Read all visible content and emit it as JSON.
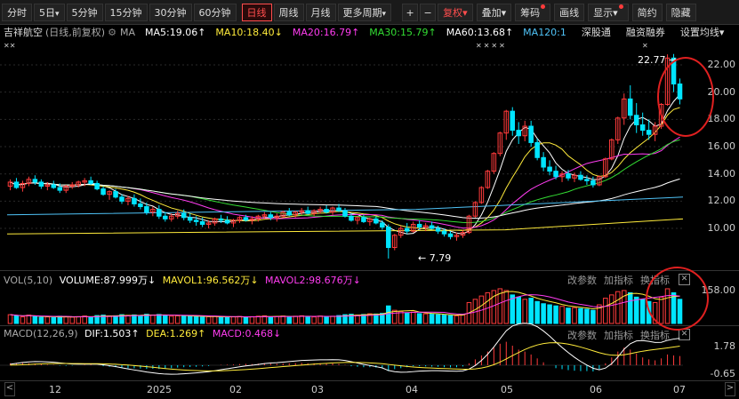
{
  "toolbar": {
    "periods": [
      "分时",
      "5日",
      "5分钟",
      "15分钟",
      "30分钟",
      "60分钟",
      "日线",
      "周线",
      "月线",
      "更多周期"
    ],
    "active": "日线",
    "plus": "+",
    "minus": "−",
    "fq": "复权",
    "right": [
      "叠加",
      "筹码",
      "画线",
      "显示",
      "简约",
      "隐藏"
    ]
  },
  "stock": {
    "name": "吉祥航空",
    "mode": "(日线,前复权)"
  },
  "ma": {
    "label": "MA",
    "items": [
      {
        "text": "MA5:19.06",
        "arrow": "↑",
        "color": "#ffffff"
      },
      {
        "text": "MA10:18.40",
        "arrow": "↓",
        "color": "#ffeb3b"
      },
      {
        "text": "MA20:16.79",
        "arrow": "↑",
        "color": "#ff3cf0"
      },
      {
        "text": "MA30:15.79",
        "arrow": "↑",
        "color": "#33dd33"
      },
      {
        "text": "MA60:13.68",
        "arrow": "↑",
        "color": "#ffffff"
      },
      {
        "text": "MA120:1",
        "arrow": "",
        "color": "#4fc3f7"
      }
    ],
    "links": [
      "深股通",
      "融资融券",
      "设置均线"
    ]
  },
  "vol": {
    "label": "VOL(5,10)",
    "volume": "VOLUME:87.999万",
    "mavol1": "MAVOL1:96.562万",
    "mavol2": "MAVOL2:98.676万",
    "arrow": "↓",
    "tools": [
      "改参数",
      "加指标",
      "换指标"
    ],
    "y": [
      "158.00"
    ]
  },
  "macd": {
    "label": "MACD(12,26,9)",
    "dif": "DIF:1.503",
    "dea": "DEA:1.269",
    "macd": "MACD:0.468",
    "tools": [
      "改参数",
      "加指标",
      "换指标"
    ],
    "y": [
      "1.78",
      "-0.65"
    ]
  },
  "annotations": {
    "high": "22.77",
    "low": "7.79"
  },
  "colors": {
    "up": "#ff3b3b",
    "down": "#00e5ff",
    "ma5": "#ffffff",
    "ma10": "#ffeb3b",
    "ma20": "#ff3cf0",
    "ma30": "#33dd33",
    "ma60": "#ffffff",
    "ma120": "#4fc3f7"
  },
  "chart_data": {
    "type": "candlestick",
    "y_ticks": [
      10,
      12,
      14,
      16,
      18,
      20,
      22
    ],
    "y_tick_labels": [
      "10.00",
      "12.00",
      "14.00",
      "16.00",
      "18.00",
      "20.00",
      "22.00"
    ],
    "ylim": [
      7.2,
      23.5
    ],
    "x_labels": [
      "12",
      "2025",
      "02",
      "03",
      "04",
      "05",
      "06",
      "07"
    ],
    "candles": [
      [
        13.1,
        13.6,
        12.8,
        13.4
      ],
      [
        13.4,
        13.7,
        12.9,
        13.0
      ],
      [
        13.0,
        13.5,
        12.7,
        13.3
      ],
      [
        13.3,
        13.8,
        13.1,
        13.6
      ],
      [
        13.6,
        13.9,
        13.2,
        13.4
      ],
      [
        13.4,
        13.6,
        12.9,
        13.1
      ],
      [
        13.1,
        13.4,
        12.8,
        13.2
      ],
      [
        13.2,
        13.5,
        12.9,
        13.0
      ],
      [
        13.0,
        13.3,
        12.6,
        12.8
      ],
      [
        12.8,
        13.2,
        12.6,
        13.1
      ],
      [
        13.1,
        13.4,
        12.9,
        13.2
      ],
      [
        13.2,
        13.5,
        13.0,
        13.4
      ],
      [
        13.4,
        13.7,
        13.1,
        13.5
      ],
      [
        13.5,
        13.8,
        13.2,
        13.3
      ],
      [
        13.3,
        13.5,
        12.8,
        12.9
      ],
      [
        12.9,
        13.1,
        12.4,
        12.5
      ],
      [
        12.5,
        12.8,
        12.1,
        12.7
      ],
      [
        12.7,
        12.9,
        12.2,
        12.3
      ],
      [
        12.3,
        12.5,
        11.8,
        12.0
      ],
      [
        12.0,
        12.4,
        11.7,
        12.2
      ],
      [
        12.2,
        12.5,
        11.6,
        11.8
      ],
      [
        11.8,
        12.2,
        11.4,
        11.6
      ],
      [
        11.6,
        11.9,
        11.0,
        11.2
      ],
      [
        11.2,
        11.6,
        10.9,
        11.4
      ],
      [
        11.4,
        11.7,
        10.7,
        10.9
      ],
      [
        10.9,
        11.2,
        10.5,
        10.7
      ],
      [
        10.7,
        11.1,
        10.5,
        10.9
      ],
      [
        10.9,
        11.3,
        10.7,
        11.1
      ],
      [
        11.1,
        11.4,
        10.6,
        10.8
      ],
      [
        10.8,
        11.1,
        10.4,
        10.6
      ],
      [
        10.6,
        10.9,
        10.2,
        10.5
      ],
      [
        10.5,
        10.8,
        10.1,
        10.3
      ],
      [
        10.3,
        10.6,
        10.0,
        10.4
      ],
      [
        10.4,
        10.8,
        10.2,
        10.7
      ],
      [
        10.7,
        11.0,
        10.4,
        10.6
      ],
      [
        10.6,
        10.9,
        10.3,
        10.4
      ],
      [
        10.4,
        10.7,
        10.1,
        10.6
      ],
      [
        10.6,
        10.9,
        10.4,
        10.8
      ],
      [
        10.8,
        11.0,
        10.5,
        10.6
      ],
      [
        10.6,
        10.9,
        10.3,
        10.7
      ],
      [
        10.7,
        11.0,
        10.5,
        10.9
      ],
      [
        10.9,
        11.2,
        10.7,
        11.0
      ],
      [
        11.0,
        11.2,
        10.6,
        10.8
      ],
      [
        10.8,
        11.1,
        10.5,
        10.9
      ],
      [
        10.9,
        11.3,
        10.8,
        11.2
      ],
      [
        11.2,
        11.5,
        10.9,
        11.0
      ],
      [
        11.0,
        11.3,
        10.8,
        11.2
      ],
      [
        11.2,
        11.5,
        11.0,
        11.3
      ],
      [
        11.3,
        11.6,
        11.0,
        11.1
      ],
      [
        11.1,
        11.4,
        10.9,
        11.3
      ],
      [
        11.3,
        11.6,
        11.1,
        11.4
      ],
      [
        11.4,
        11.7,
        11.1,
        11.2
      ],
      [
        11.2,
        11.6,
        11.0,
        11.5
      ],
      [
        11.5,
        11.8,
        11.2,
        11.3
      ],
      [
        11.3,
        11.5,
        10.8,
        10.9
      ],
      [
        10.9,
        11.1,
        10.5,
        10.6
      ],
      [
        10.6,
        10.9,
        10.3,
        10.8
      ],
      [
        10.8,
        11.0,
        10.4,
        10.5
      ],
      [
        10.5,
        10.8,
        10.2,
        10.7
      ],
      [
        10.7,
        10.9,
        10.3,
        10.4
      ],
      [
        10.4,
        10.6,
        9.9,
        10.1
      ],
      [
        10.1,
        10.3,
        7.79,
        8.6
      ],
      [
        8.6,
        9.6,
        8.4,
        9.5
      ],
      [
        9.5,
        10.2,
        9.3,
        10.0
      ],
      [
        10.0,
        10.4,
        9.6,
        9.8
      ],
      [
        9.8,
        10.5,
        9.7,
        10.3
      ],
      [
        10.3,
        10.6,
        9.9,
        10.1
      ],
      [
        10.1,
        10.4,
        9.8,
        10.2
      ],
      [
        10.2,
        10.5,
        9.9,
        10.0
      ],
      [
        10.0,
        10.2,
        9.6,
        9.8
      ],
      [
        9.8,
        10.0,
        9.4,
        9.6
      ],
      [
        9.6,
        9.8,
        9.2,
        9.4
      ],
      [
        9.4,
        9.7,
        9.1,
        9.5
      ],
      [
        9.5,
        9.9,
        9.3,
        9.7
      ],
      [
        9.7,
        11.0,
        9.6,
        10.9
      ],
      [
        10.9,
        12.0,
        10.8,
        11.9
      ],
      [
        11.9,
        13.1,
        11.8,
        13.0
      ],
      [
        13.0,
        14.3,
        12.9,
        14.2
      ],
      [
        14.2,
        15.6,
        14.0,
        15.5
      ],
      [
        15.5,
        17.1,
        15.3,
        17.0
      ],
      [
        17.0,
        18.7,
        16.5,
        18.6
      ],
      [
        18.6,
        18.9,
        16.8,
        17.2
      ],
      [
        17.2,
        17.8,
        16.2,
        16.8
      ],
      [
        16.8,
        17.9,
        16.4,
        17.5
      ],
      [
        17.5,
        17.9,
        16.0,
        16.3
      ],
      [
        16.3,
        16.6,
        15.0,
        15.2
      ],
      [
        15.2,
        15.6,
        14.2,
        14.5
      ],
      [
        14.5,
        15.0,
        13.9,
        14.2
      ],
      [
        14.2,
        14.6,
        13.6,
        13.8
      ],
      [
        13.8,
        14.2,
        13.4,
        14.0
      ],
      [
        14.0,
        14.3,
        13.5,
        13.7
      ],
      [
        13.7,
        14.1,
        13.4,
        13.9
      ],
      [
        13.9,
        14.2,
        13.5,
        13.6
      ],
      [
        13.6,
        13.9,
        13.2,
        13.5
      ],
      [
        13.5,
        13.8,
        13.0,
        13.2
      ],
      [
        13.2,
        13.9,
        13.1,
        13.8
      ],
      [
        13.8,
        15.2,
        13.7,
        15.1
      ],
      [
        15.1,
        16.6,
        15.0,
        16.5
      ],
      [
        16.5,
        18.2,
        16.2,
        18.1
      ],
      [
        18.1,
        19.9,
        17.6,
        19.5
      ],
      [
        19.5,
        20.5,
        18.0,
        18.3
      ],
      [
        18.3,
        19.2,
        17.0,
        17.6
      ],
      [
        17.6,
        18.5,
        16.8,
        17.2
      ],
      [
        17.2,
        18.0,
        16.5,
        16.9
      ],
      [
        16.9,
        17.8,
        16.4,
        17.5
      ],
      [
        17.5,
        19.2,
        17.3,
        19.1
      ],
      [
        19.1,
        22.77,
        19.0,
        22.5
      ],
      [
        22.5,
        22.8,
        20.0,
        20.6
      ],
      [
        20.6,
        21.0,
        19.1,
        19.5
      ]
    ],
    "volume": [
      40,
      35,
      30,
      38,
      32,
      28,
      30,
      27,
      33,
      30,
      29,
      31,
      34,
      30,
      36,
      38,
      33,
      35,
      40,
      37,
      39,
      36,
      42,
      38,
      41,
      37,
      33,
      35,
      36,
      34,
      30,
      29,
      31,
      33,
      30,
      28,
      30,
      32,
      29,
      31,
      33,
      35,
      30,
      32,
      34,
      31,
      33,
      35,
      32,
      30,
      34,
      31,
      33,
      36,
      40,
      42,
      38,
      41,
      44,
      43,
      46,
      80,
      60,
      55,
      48,
      52,
      45,
      44,
      42,
      40,
      38,
      36,
      35,
      40,
      95,
      110,
      125,
      140,
      150,
      158,
      150,
      130,
      120,
      110,
      115,
      100,
      90,
      85,
      80,
      78,
      70,
      72,
      68,
      65,
      60,
      85,
      115,
      130,
      145,
      150,
      140,
      120,
      110,
      100,
      95,
      120,
      158,
      140,
      110
    ],
    "macd_hist": [
      0.1,
      0.1,
      0.12,
      0.1,
      0.08,
      0.05,
      0.03,
      0.02,
      -0.02,
      -0.03,
      -0.02,
      0.0,
      0.02,
      0.03,
      0.0,
      -0.05,
      -0.08,
      -0.1,
      -0.14,
      -0.15,
      -0.16,
      -0.17,
      -0.19,
      -0.18,
      -0.19,
      -0.18,
      -0.15,
      -0.12,
      -0.1,
      -0.09,
      -0.08,
      -0.06,
      -0.04,
      0.0,
      0.02,
      0.03,
      0.04,
      0.06,
      0.07,
      0.06,
      0.08,
      0.1,
      0.08,
      0.07,
      0.09,
      0.1,
      0.11,
      0.12,
      0.1,
      0.1,
      0.1,
      0.08,
      0.09,
      0.07,
      0.02,
      -0.05,
      -0.08,
      -0.1,
      -0.1,
      -0.12,
      -0.15,
      -0.3,
      -0.2,
      -0.15,
      -0.1,
      -0.05,
      -0.05,
      -0.06,
      -0.07,
      -0.08,
      -0.1,
      -0.11,
      -0.1,
      -0.06,
      0.1,
      0.3,
      0.5,
      0.7,
      0.9,
      1.1,
      1.2,
      1.0,
      0.8,
      0.7,
      0.55,
      0.35,
      0.15,
      0.0,
      -0.15,
      -0.2,
      -0.25,
      -0.28,
      -0.3,
      -0.3,
      -0.32,
      -0.2,
      0.1,
      0.4,
      0.7,
      0.9,
      0.8,
      0.6,
      0.4,
      0.3,
      0.25,
      0.35,
      0.55,
      0.5,
      0.47
    ]
  }
}
